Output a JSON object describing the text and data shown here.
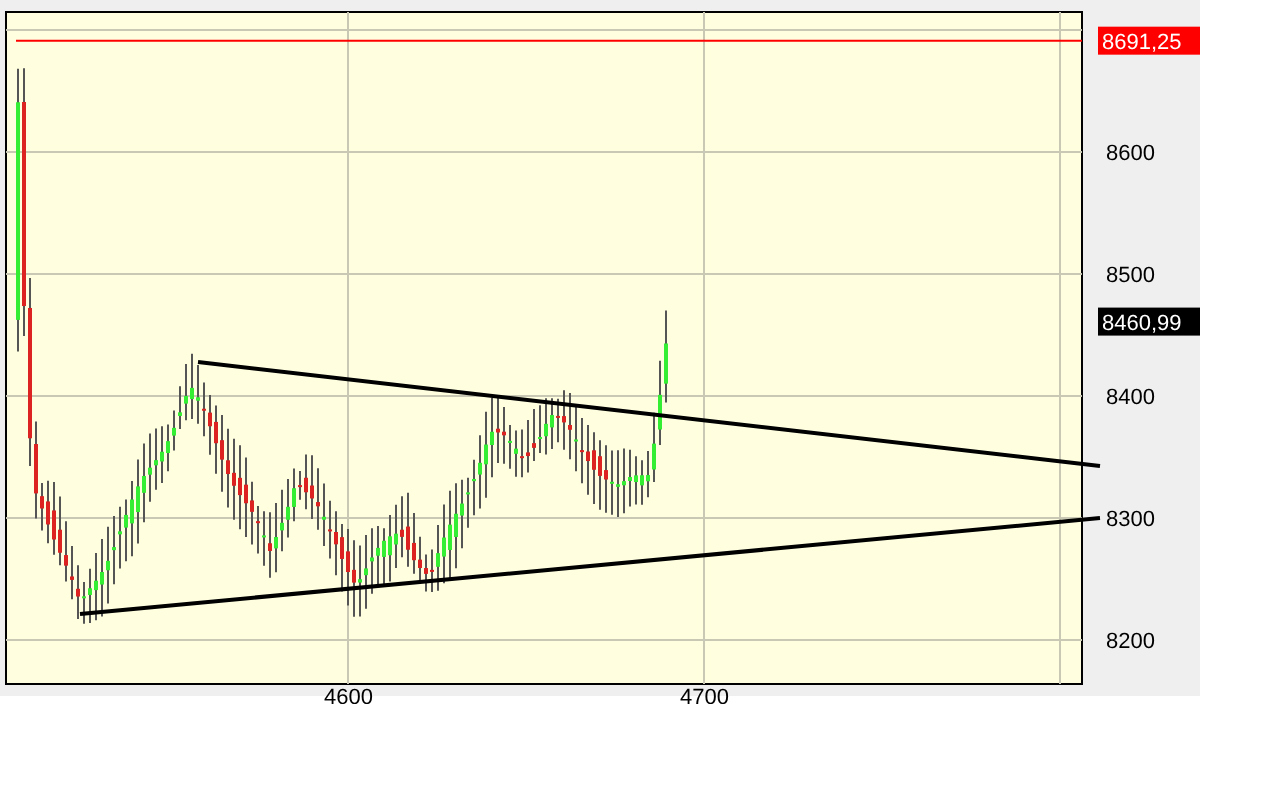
{
  "chart": {
    "y_axis_labels": [
      "8600",
      "8500",
      "8400",
      "8300",
      "8200"
    ],
    "x_axis_labels": [
      "4600",
      "4700"
    ],
    "price_markers": [
      {
        "kind": "line",
        "text": "8691,25",
        "color": "#ff0000"
      },
      {
        "kind": "last",
        "text": "8460,99",
        "color": "#000000"
      }
    ]
  }
}
